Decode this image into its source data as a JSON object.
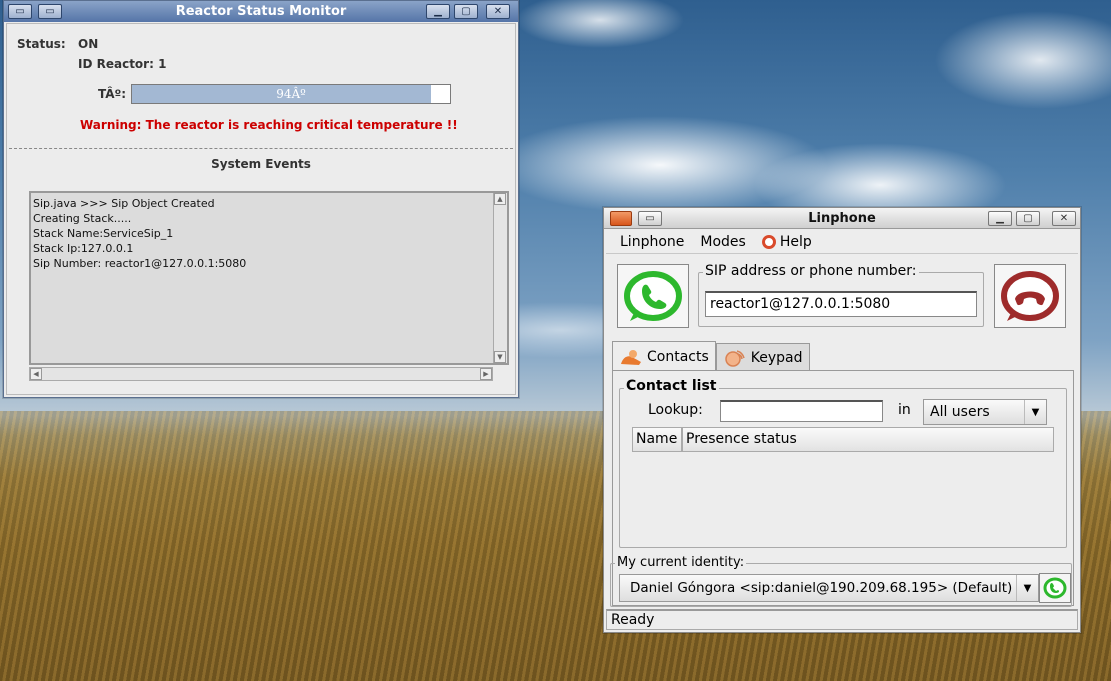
{
  "reactor_window": {
    "title": "Reactor Status Monitor",
    "status_label": "Status:",
    "status_value": "ON",
    "id_label": "ID Reactor: 1",
    "temp_label": "TÂº:",
    "temp_value_text": "94Âº",
    "temp_percent": 94,
    "warning": "Warning: The reactor is reaching critical temperature !!",
    "events_title": "System Events",
    "events": [
      "Sip.java >>> Sip Object Created",
      "Creating Stack.....",
      "Stack Name:ServiceSip_1",
      "Stack Ip:127.0.0.1",
      "Sip Number: reactor1@127.0.0.1:5080"
    ]
  },
  "linphone_window": {
    "title": "Linphone",
    "menu": {
      "linphone": "Linphone",
      "modes": "Modes",
      "help": "Help"
    },
    "sip_label": "SIP address or phone number:",
    "sip_value": "reactor1@127.0.0.1:5080",
    "tabs": {
      "contacts": "Contacts",
      "keypad": "Keypad"
    },
    "contact_list": {
      "title": "Contact list",
      "lookup_label": "Lookup:",
      "lookup_value": "",
      "in_label": "in",
      "filter_value": "All users",
      "columns": [
        "Name",
        "Presence status"
      ]
    },
    "identity_label": "My current identity:",
    "identity_value": "Daniel Góngora <sip:daniel@190.209.68.195> (Default)",
    "status": "Ready"
  },
  "colors": {
    "warning": "#cc0000",
    "call_green": "#2db82d",
    "hangup_red": "#9e2b2b",
    "progress_fill": "#a3b8d3"
  }
}
